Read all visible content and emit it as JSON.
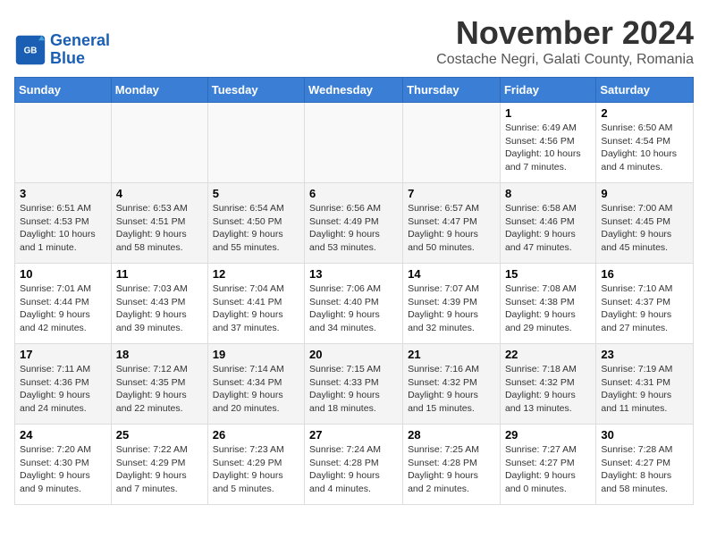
{
  "logo": {
    "line1": "General",
    "line2": "Blue"
  },
  "title": "November 2024",
  "location": "Costache Negri, Galati County, Romania",
  "headers": [
    "Sunday",
    "Monday",
    "Tuesday",
    "Wednesday",
    "Thursday",
    "Friday",
    "Saturday"
  ],
  "weeks": [
    [
      {
        "day": "",
        "content": ""
      },
      {
        "day": "",
        "content": ""
      },
      {
        "day": "",
        "content": ""
      },
      {
        "day": "",
        "content": ""
      },
      {
        "day": "",
        "content": ""
      },
      {
        "day": "1",
        "content": "Sunrise: 6:49 AM\nSunset: 4:56 PM\nDaylight: 10 hours and 7 minutes."
      },
      {
        "day": "2",
        "content": "Sunrise: 6:50 AM\nSunset: 4:54 PM\nDaylight: 10 hours and 4 minutes."
      }
    ],
    [
      {
        "day": "3",
        "content": "Sunrise: 6:51 AM\nSunset: 4:53 PM\nDaylight: 10 hours and 1 minute."
      },
      {
        "day": "4",
        "content": "Sunrise: 6:53 AM\nSunset: 4:51 PM\nDaylight: 9 hours and 58 minutes."
      },
      {
        "day": "5",
        "content": "Sunrise: 6:54 AM\nSunset: 4:50 PM\nDaylight: 9 hours and 55 minutes."
      },
      {
        "day": "6",
        "content": "Sunrise: 6:56 AM\nSunset: 4:49 PM\nDaylight: 9 hours and 53 minutes."
      },
      {
        "day": "7",
        "content": "Sunrise: 6:57 AM\nSunset: 4:47 PM\nDaylight: 9 hours and 50 minutes."
      },
      {
        "day": "8",
        "content": "Sunrise: 6:58 AM\nSunset: 4:46 PM\nDaylight: 9 hours and 47 minutes."
      },
      {
        "day": "9",
        "content": "Sunrise: 7:00 AM\nSunset: 4:45 PM\nDaylight: 9 hours and 45 minutes."
      }
    ],
    [
      {
        "day": "10",
        "content": "Sunrise: 7:01 AM\nSunset: 4:44 PM\nDaylight: 9 hours and 42 minutes."
      },
      {
        "day": "11",
        "content": "Sunrise: 7:03 AM\nSunset: 4:43 PM\nDaylight: 9 hours and 39 minutes."
      },
      {
        "day": "12",
        "content": "Sunrise: 7:04 AM\nSunset: 4:41 PM\nDaylight: 9 hours and 37 minutes."
      },
      {
        "day": "13",
        "content": "Sunrise: 7:06 AM\nSunset: 4:40 PM\nDaylight: 9 hours and 34 minutes."
      },
      {
        "day": "14",
        "content": "Sunrise: 7:07 AM\nSunset: 4:39 PM\nDaylight: 9 hours and 32 minutes."
      },
      {
        "day": "15",
        "content": "Sunrise: 7:08 AM\nSunset: 4:38 PM\nDaylight: 9 hours and 29 minutes."
      },
      {
        "day": "16",
        "content": "Sunrise: 7:10 AM\nSunset: 4:37 PM\nDaylight: 9 hours and 27 minutes."
      }
    ],
    [
      {
        "day": "17",
        "content": "Sunrise: 7:11 AM\nSunset: 4:36 PM\nDaylight: 9 hours and 24 minutes."
      },
      {
        "day": "18",
        "content": "Sunrise: 7:12 AM\nSunset: 4:35 PM\nDaylight: 9 hours and 22 minutes."
      },
      {
        "day": "19",
        "content": "Sunrise: 7:14 AM\nSunset: 4:34 PM\nDaylight: 9 hours and 20 minutes."
      },
      {
        "day": "20",
        "content": "Sunrise: 7:15 AM\nSunset: 4:33 PM\nDaylight: 9 hours and 18 minutes."
      },
      {
        "day": "21",
        "content": "Sunrise: 7:16 AM\nSunset: 4:32 PM\nDaylight: 9 hours and 15 minutes."
      },
      {
        "day": "22",
        "content": "Sunrise: 7:18 AM\nSunset: 4:32 PM\nDaylight: 9 hours and 13 minutes."
      },
      {
        "day": "23",
        "content": "Sunrise: 7:19 AM\nSunset: 4:31 PM\nDaylight: 9 hours and 11 minutes."
      }
    ],
    [
      {
        "day": "24",
        "content": "Sunrise: 7:20 AM\nSunset: 4:30 PM\nDaylight: 9 hours and 9 minutes."
      },
      {
        "day": "25",
        "content": "Sunrise: 7:22 AM\nSunset: 4:29 PM\nDaylight: 9 hours and 7 minutes."
      },
      {
        "day": "26",
        "content": "Sunrise: 7:23 AM\nSunset: 4:29 PM\nDaylight: 9 hours and 5 minutes."
      },
      {
        "day": "27",
        "content": "Sunrise: 7:24 AM\nSunset: 4:28 PM\nDaylight: 9 hours and 4 minutes."
      },
      {
        "day": "28",
        "content": "Sunrise: 7:25 AM\nSunset: 4:28 PM\nDaylight: 9 hours and 2 minutes."
      },
      {
        "day": "29",
        "content": "Sunrise: 7:27 AM\nSunset: 4:27 PM\nDaylight: 9 hours and 0 minutes."
      },
      {
        "day": "30",
        "content": "Sunrise: 7:28 AM\nSunset: 4:27 PM\nDaylight: 8 hours and 58 minutes."
      }
    ]
  ]
}
